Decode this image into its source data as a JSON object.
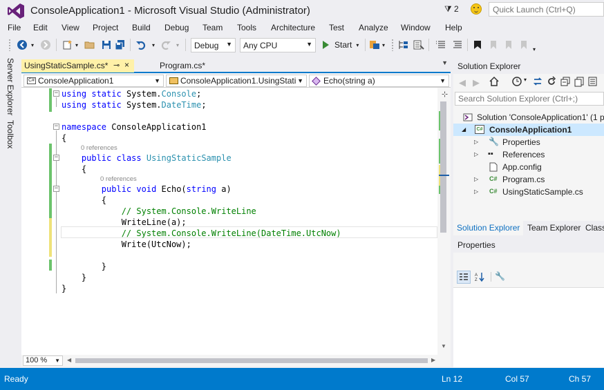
{
  "window": {
    "title": "ConsoleApplication1 - Microsoft Visual Studio (Administrator)",
    "notification_count": "2",
    "quick_launch_placeholder": "Quick Launch (Ctrl+Q)"
  },
  "menu": [
    "File",
    "Edit",
    "View",
    "Project",
    "Build",
    "Debug",
    "Team",
    "Tools",
    "Architecture",
    "Test",
    "Analyze",
    "Window",
    "Help"
  ],
  "toolbar": {
    "configuration": "Debug",
    "platform": "Any CPU",
    "start_label": "Start"
  },
  "side_rail": [
    "Server Explorer",
    "Toolbox"
  ],
  "document_tabs": [
    {
      "label": "UsingStaticSample.cs*",
      "active": true
    },
    {
      "label": "Program.cs*",
      "active": false
    }
  ],
  "nav_bar": {
    "project": "ConsoleApplication1",
    "type": "ConsoleApplication1.UsingStati",
    "member": "Echo(string a)"
  },
  "code": {
    "lines": [
      {
        "tokens": [
          [
            "kw",
            "using"
          ],
          [
            "",
            " "
          ],
          [
            "kw",
            "static"
          ],
          [
            "",
            " System."
          ],
          [
            "ty",
            "Console"
          ],
          [
            "",
            ";"
          ]
        ]
      },
      {
        "tokens": [
          [
            "kw",
            "using"
          ],
          [
            "",
            " "
          ],
          [
            "kw",
            "static"
          ],
          [
            "",
            " System."
          ],
          [
            "ty",
            "DateTime"
          ],
          [
            "",
            ";"
          ]
        ]
      },
      {
        "tokens": []
      },
      {
        "tokens": [
          [
            "kw",
            "namespace"
          ],
          [
            "",
            " ConsoleApplication1"
          ]
        ]
      },
      {
        "tokens": [
          [
            "",
            "{"
          ]
        ]
      },
      {
        "tokens": [
          [
            "",
            "    "
          ],
          [
            "kw",
            "public"
          ],
          [
            "",
            " "
          ],
          [
            "kw",
            "class"
          ],
          [
            "",
            " "
          ],
          [
            "ty",
            "UsingStaticSample"
          ]
        ]
      },
      {
        "tokens": [
          [
            "",
            "    {"
          ]
        ]
      },
      {
        "tokens": [
          [
            "",
            "        "
          ],
          [
            "kw",
            "public"
          ],
          [
            "",
            " "
          ],
          [
            "kw",
            "void"
          ],
          [
            "",
            " Echo("
          ],
          [
            "kw",
            "string"
          ],
          [
            "",
            " a)"
          ]
        ]
      },
      {
        "tokens": [
          [
            "",
            "        {"
          ]
        ]
      },
      {
        "tokens": [
          [
            "",
            "            "
          ],
          [
            "cm",
            "// System.Console.WriteLine"
          ]
        ]
      },
      {
        "tokens": [
          [
            "",
            "            WriteLine(a);"
          ]
        ]
      },
      {
        "tokens": [
          [
            "",
            "            "
          ],
          [
            "cm",
            "// System.Console.WriteLine(DateTime.UtcNow)"
          ]
        ]
      },
      {
        "tokens": [
          [
            "",
            "            Write(UtcNow);"
          ]
        ]
      },
      {
        "tokens": []
      },
      {
        "tokens": [
          [
            "",
            "        }"
          ]
        ]
      },
      {
        "tokens": [
          [
            "",
            "    }"
          ]
        ]
      },
      {
        "tokens": [
          [
            "",
            "}"
          ]
        ]
      }
    ],
    "class_references": "0 references",
    "method_references": "0 references"
  },
  "zoom_level": "100 %",
  "solution_explorer": {
    "title": "Solution Explorer",
    "search_placeholder": "Search Solution Explorer (Ctrl+;)",
    "solution": "Solution 'ConsoleApplication1' (1 p",
    "project": "ConsoleApplication1",
    "items": [
      "Properties",
      "References",
      "App.config",
      "Program.cs",
      "UsingStaticSample.cs"
    ],
    "bottom_tabs": [
      "Solution Explorer",
      "Team Explorer",
      "Class"
    ]
  },
  "properties": {
    "title": "Properties"
  },
  "status_bar": {
    "state": "Ready",
    "line": "Ln 12",
    "column": "Col 57",
    "char": "Ch 57"
  },
  "colors": {
    "accent": "#007acc",
    "keyword": "#0000ff",
    "type": "#2b91af",
    "comment": "#008000",
    "vs_purple": "#68217a"
  }
}
